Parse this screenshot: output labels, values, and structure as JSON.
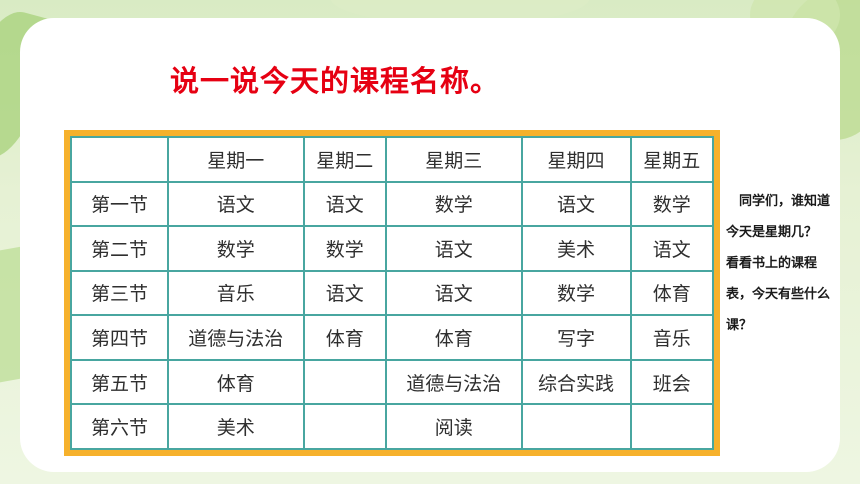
{
  "title": "说一说今天的课程名称。",
  "timetable": {
    "headers": [
      "",
      "星期一",
      "星期二",
      "星期三",
      "星期四",
      "星期五"
    ],
    "rows": [
      {
        "period": "第一节",
        "cells": [
          "语文",
          "语文",
          "数学",
          "语文",
          "数学"
        ]
      },
      {
        "period": "第二节",
        "cells": [
          "数学",
          "数学",
          "语文",
          "美术",
          "语文"
        ]
      },
      {
        "period": "第三节",
        "cells": [
          "音乐",
          "语文",
          "语文",
          "数学",
          "体育"
        ]
      },
      {
        "period": "第四节",
        "cells": [
          "道德与法治",
          "体育",
          "体育",
          "写字",
          "音乐"
        ]
      },
      {
        "period": "第五节",
        "cells": [
          "体育",
          "",
          "道德与法治",
          "综合实践",
          "班会"
        ]
      },
      {
        "period": "第六节",
        "cells": [
          "美术",
          "",
          "阅读",
          "",
          ""
        ]
      }
    ]
  },
  "side_note": {
    "question1": "同学们，谁知道今天是星期几？",
    "question2": "看看书上的课程表，今天有些什么课？"
  },
  "colors": {
    "title": "#e60012",
    "table_frame": "#f6b12c",
    "grid_lines": "#48a6a0",
    "background": "#e6f1d4"
  }
}
